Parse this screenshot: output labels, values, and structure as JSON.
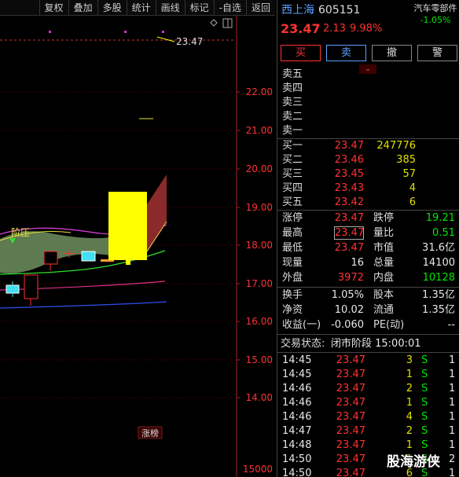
{
  "toolbar": {
    "items": [
      "复权",
      "叠加",
      "多股",
      "统计",
      "画线",
      "标记",
      "-自选",
      "返回"
    ]
  },
  "chart": {
    "price_axis": [
      "22.00",
      "21.00",
      "20.00",
      "19.00",
      "18.00",
      "17.00",
      "16.00",
      "15.00",
      "14.00"
    ],
    "high_marker": "23.47",
    "bottom_value": "15000",
    "pressure_label": "阶压",
    "limit_badge": "涨榜"
  },
  "stock": {
    "name": "西上海",
    "code": "605151",
    "price": "23.47",
    "change": "2.13",
    "change_pct": "9.98%",
    "sector": "汽车零部件",
    "sector_pct": "-1.05%"
  },
  "trade_buttons": [
    "买",
    "卖",
    "撤",
    "警"
  ],
  "asks": [
    {
      "label": "卖五",
      "price": "",
      "vol": ""
    },
    {
      "label": "卖四",
      "price": "",
      "vol": ""
    },
    {
      "label": "卖三",
      "price": "",
      "vol": ""
    },
    {
      "label": "卖二",
      "price": "",
      "vol": ""
    },
    {
      "label": "卖一",
      "price": "",
      "vol": ""
    }
  ],
  "bids": [
    {
      "label": "买一",
      "price": "23.47",
      "vol": "247776"
    },
    {
      "label": "买二",
      "price": "23.46",
      "vol": "385"
    },
    {
      "label": "买三",
      "price": "23.45",
      "vol": "57"
    },
    {
      "label": "买四",
      "price": "23.43",
      "vol": "4"
    },
    {
      "label": "买五",
      "price": "23.42",
      "vol": "6"
    }
  ],
  "stats": [
    {
      "l1": "涨停",
      "v1": "23.47",
      "l2": "跌停",
      "v2": "19.21"
    },
    {
      "l1": "最高",
      "v1": "23.47",
      "l2": "量比",
      "v2": "0.51"
    },
    {
      "l1": "最低",
      "v1": "23.47",
      "l2": "市值",
      "v2": "31.6亿"
    },
    {
      "l1": "现量",
      "v1": "16",
      "l2": "总量",
      "v2": "14100"
    },
    {
      "l1": "外盘",
      "v1": "3972",
      "l2": "内盘",
      "v2": "10128"
    }
  ],
  "stats2": [
    {
      "l1": "换手",
      "v1": "1.05%",
      "l2": "股本",
      "v2": "1.35亿"
    },
    {
      "l1": "净资",
      "v1": "10.02",
      "l2": "流通",
      "v2": "1.35亿"
    },
    {
      "l1": "收益(一)",
      "v1": "-0.060",
      "l2": "PE(动)",
      "v2": "--"
    }
  ],
  "status": {
    "label": "交易状态:",
    "value": "闭市阶段 15:00:01"
  },
  "ticks": [
    {
      "time": "14:45",
      "price": "23.47",
      "vol": "3",
      "side": "S",
      "n": "1"
    },
    {
      "time": "14:45",
      "price": "23.47",
      "vol": "1",
      "side": "S",
      "n": "1"
    },
    {
      "time": "14:46",
      "price": "23.47",
      "vol": "2",
      "side": "S",
      "n": "1"
    },
    {
      "time": "14:46",
      "price": "23.47",
      "vol": "1",
      "side": "S",
      "n": "1"
    },
    {
      "time": "14:46",
      "price": "23.47",
      "vol": "4",
      "side": "S",
      "n": "1"
    },
    {
      "time": "14:47",
      "price": "23.47",
      "vol": "2",
      "side": "S",
      "n": "1"
    },
    {
      "time": "14:48",
      "price": "23.47",
      "vol": "1",
      "side": "S",
      "n": "1"
    },
    {
      "time": "14:50",
      "price": "23.47",
      "vol": "1",
      "side": "S",
      "n": "2"
    },
    {
      "time": "14:50",
      "price": "23.47",
      "vol": "6",
      "side": "S",
      "n": "1"
    }
  ],
  "watermark": "股海游侠"
}
